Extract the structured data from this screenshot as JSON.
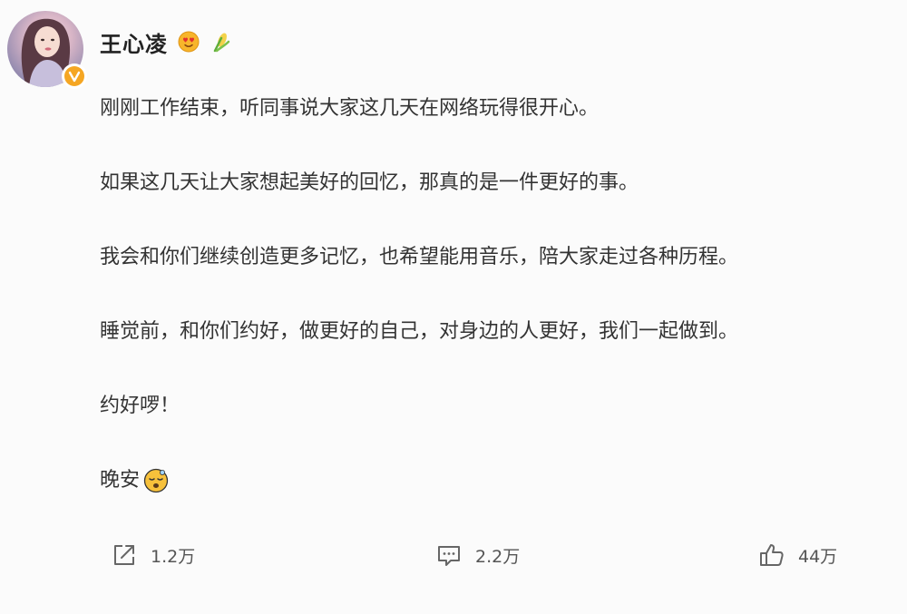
{
  "user": {
    "name": "王心凌",
    "avatar_icon": "avatar-photo",
    "verified_icon": "verified-v-icon",
    "badges": [
      "heart-eyes-emoji-icon",
      "corn-emoji-icon"
    ]
  },
  "post": {
    "paragraphs": [
      "刚刚工作结束，听同事说大家这几天在网络玩得很开心。",
      "如果这几天让大家想起美好的回忆，那真的是一件更好的事。",
      "我会和你们继续创造更多记忆，也希望能用音乐，陪大家走过各种历程。",
      "睡觉前，和你们约好，做更好的自己，对身边的人更好，我们一起做到。",
      "约好啰！"
    ],
    "closing": "晚安",
    "closing_emoji": "sleeping-face-emoji-icon"
  },
  "actions": {
    "share": {
      "icon": "share-icon",
      "count": "1.2万"
    },
    "comment": {
      "icon": "comment-icon",
      "count": "2.2万"
    },
    "like": {
      "icon": "thumbs-up-icon",
      "count": "44万"
    }
  },
  "colors": {
    "verified": "#f5a623",
    "text": "#333333",
    "icon": "#666666"
  }
}
